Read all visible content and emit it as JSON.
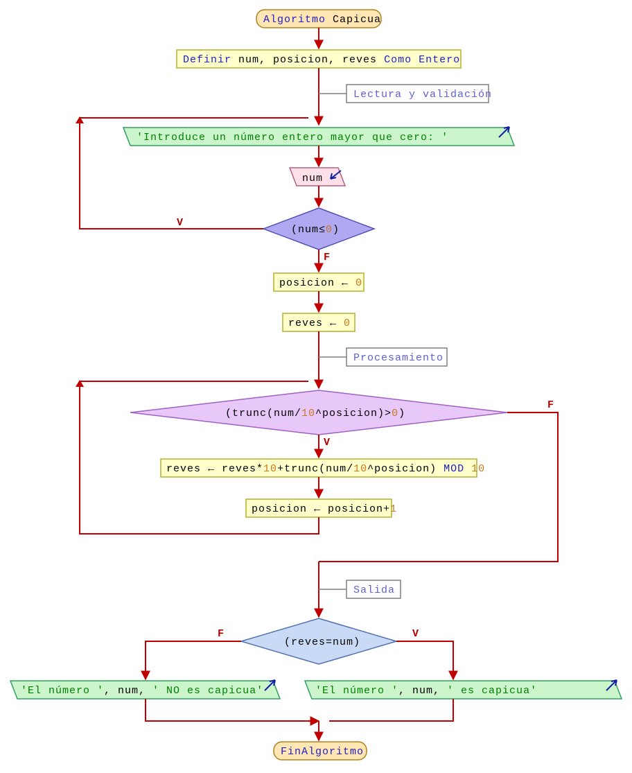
{
  "colors": {
    "terminal_fill": "#ffe6b3",
    "terminal_stroke": "#b08020",
    "process_fill": "#ffffcc",
    "process_stroke": "#b0b030",
    "io_out_fill": "#ccf5cc",
    "io_out_stroke": "#30a060",
    "io_in_fill": "#ffe0e8",
    "io_in_stroke": "#b06080",
    "decision_fill": "#b0a8f0",
    "decision_stroke": "#5050b0",
    "loop_fill": "#e8c8f8",
    "loop_stroke": "#a060c0",
    "decision2_fill": "#c8daf5",
    "decision2_stroke": "#5070b0",
    "comment_fill": "#ffffff",
    "comment_stroke": "#808080",
    "flow": "#c00000",
    "arrow_out": "#1020a0",
    "arrow_in": "#1020a0"
  },
  "nodes": {
    "start_kw": "Algoritmo",
    "start_name": " Capicua",
    "def_kw1": "Definir",
    "def_vars": " num, posicion, reves ",
    "def_kw2": "Como Entero",
    "comment1": "Lectura y validación",
    "prompt": "'Introduce un número entero mayor que cero: '",
    "read_var": "num",
    "cond1_l": "(num≤",
    "cond1_r": "0",
    "cond1_c": ")",
    "V": "V",
    "F": "F",
    "assign1_l": "posicion ",
    "assign_arrow": "←",
    "assign1_r": " 0",
    "assign2_l": "reves ",
    "assign2_r": " 0",
    "comment2": "Procesamiento",
    "loop_l": "(trunc(num/",
    "loop_n1": "10",
    "loop_m": "^posicion)>",
    "loop_n2": "0",
    "loop_c": ")",
    "body1_a": "reves ",
    "body1_b": " reves*",
    "body1_c": "10",
    "body1_d": "+trunc(num/",
    "body1_e": "10",
    "body1_f": "^posicion) ",
    "body1_g": "MOD",
    "body1_h": " 10",
    "body2_a": "posicion ",
    "body2_b": " posicion+",
    "body2_c": "1",
    "comment3": "Salida",
    "cond2": "(reves=num)",
    "out_no_a": "'El número '",
    "out_no_b": ", num, ",
    "out_no_c": "' NO es capicua'",
    "out_yes_a": "'El número '",
    "out_yes_b": ", num, ",
    "out_yes_c": "' es capicua'",
    "end": "FinAlgoritmo"
  }
}
